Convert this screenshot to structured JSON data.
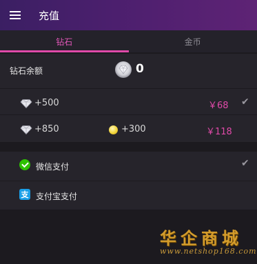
{
  "appbar": {
    "title": "充值",
    "menu_icon": "menu-icon"
  },
  "tabs": [
    {
      "label": "钻石",
      "active": true
    },
    {
      "label": "金币",
      "active": false
    }
  ],
  "balance": {
    "label": "钻石余额",
    "value": "0",
    "icon": "diamond-icon"
  },
  "packages": [
    {
      "diamonds": "+500",
      "bonus_coins": "",
      "price": "￥68",
      "selected": true
    },
    {
      "diamonds": "+850",
      "bonus_coins": "+300",
      "price": "￥118",
      "selected": false
    }
  ],
  "payment_methods": [
    {
      "label": "微信支付",
      "icon": "wechat-icon",
      "selected": true
    },
    {
      "label": "支付宝支付",
      "icon": "alipay-icon",
      "selected": false
    }
  ],
  "alipay_icon_glyph": "支",
  "check_glyph": "✔",
  "watermark": {
    "brand": "华企商城",
    "url": "www.netshop168.com"
  },
  "colors": {
    "accent": "#e04aa9",
    "appbar_start": "#3b1f63",
    "appbar_end": "#5e2375",
    "background": "#1c1a1f",
    "row_background": "#26242b"
  }
}
